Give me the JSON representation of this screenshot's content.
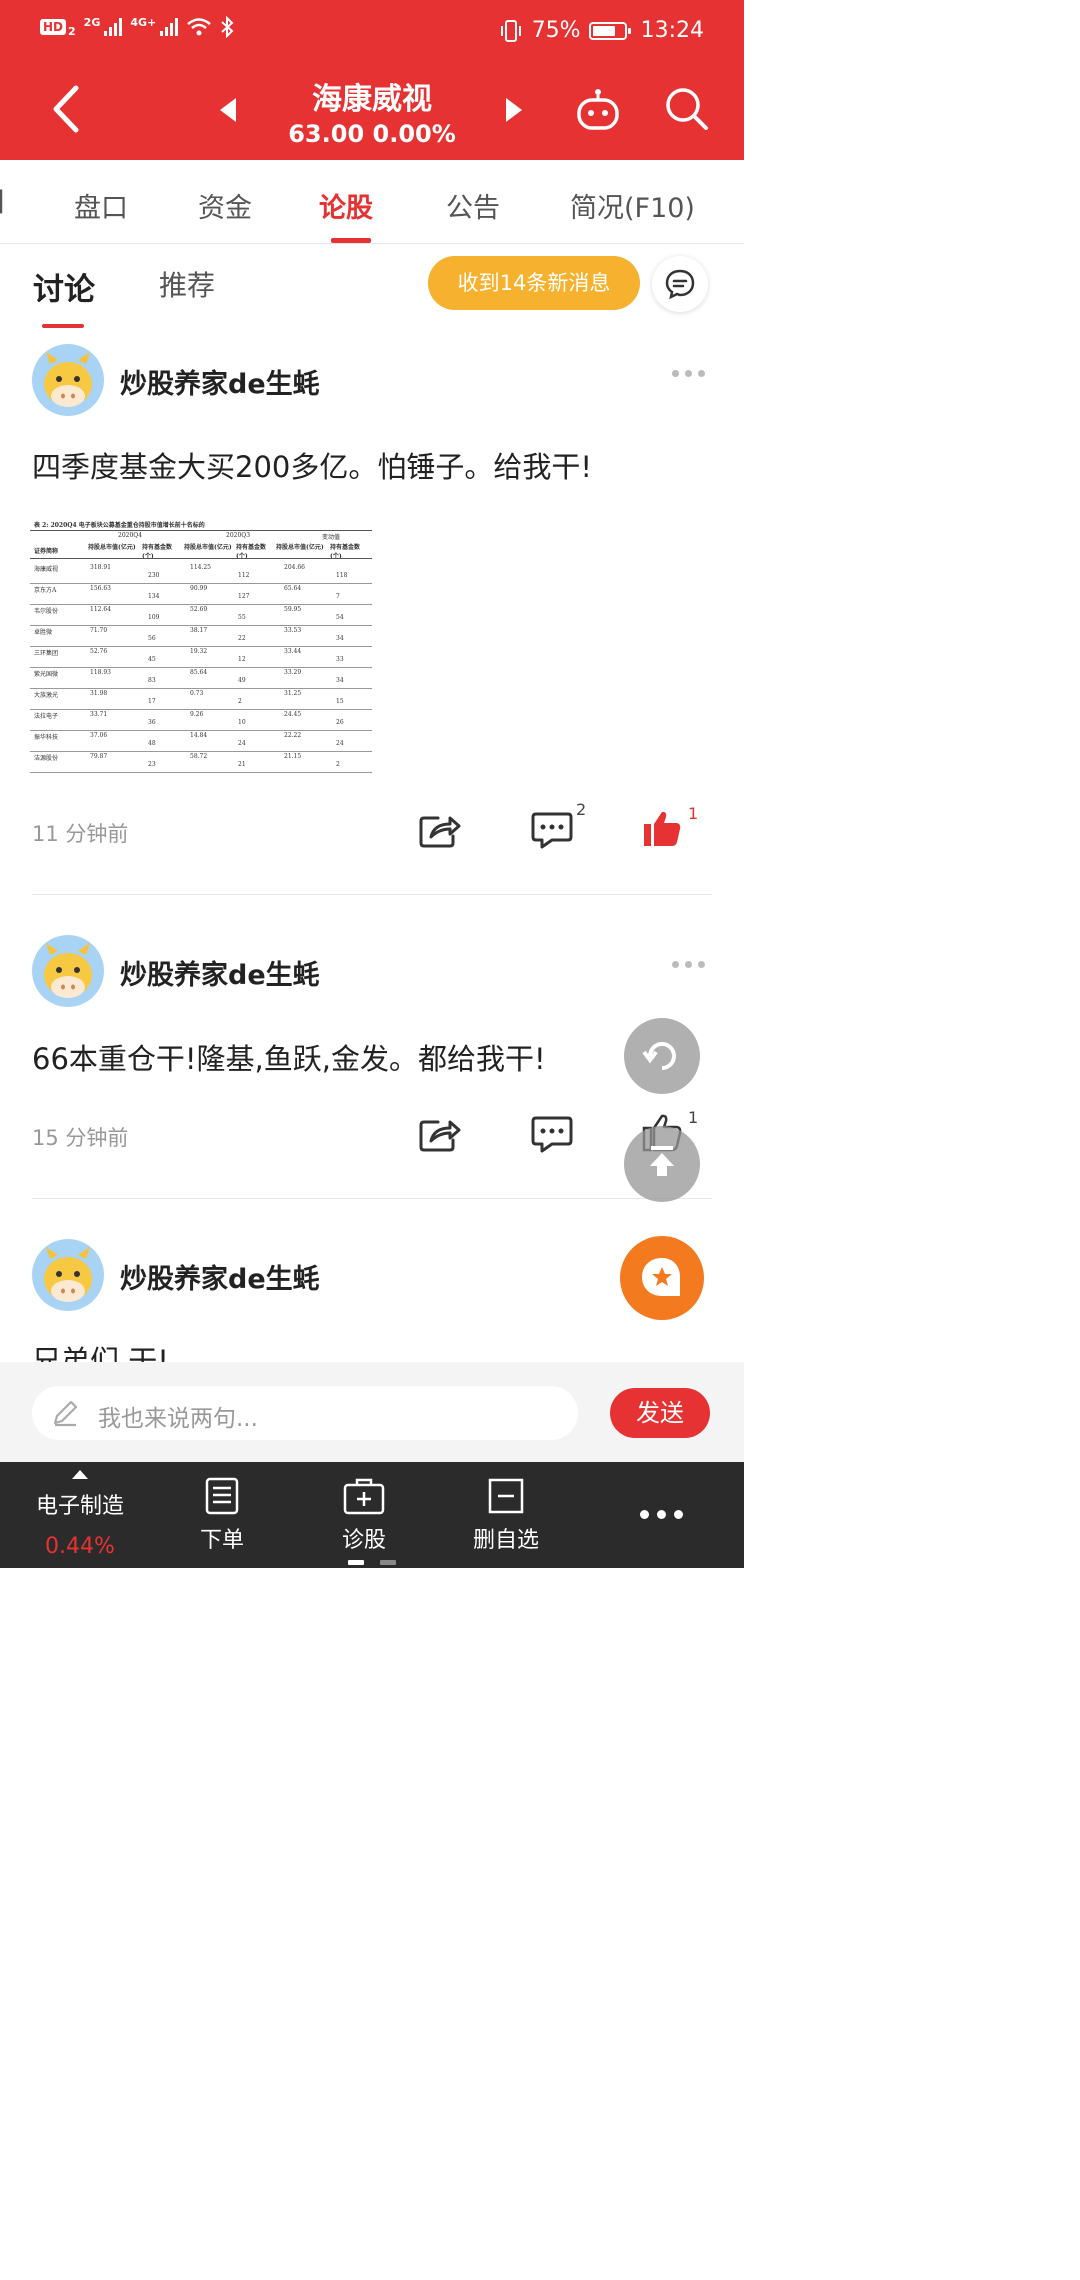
{
  "status_bar": {
    "hd": "HD",
    "sim": "2",
    "net1": "2G",
    "net2": "4G+",
    "battery": "75%",
    "time": "13:24"
  },
  "header": {
    "stock_name": "海康威视",
    "price_line": "63.00  0.00%"
  },
  "tabs": [
    "]",
    "盘口",
    "资金",
    "论股",
    "公告",
    "简况(F10)"
  ],
  "subtabs": {
    "discuss": "讨论",
    "recommend": "推荐",
    "new_messages": "收到14条新消息"
  },
  "posts": [
    {
      "username": "炒股养家de生蚝",
      "content": "四季度基金大买200多亿。怕锤子。给我干!",
      "time": "11 分钟前",
      "comments": "2",
      "likes": "1"
    },
    {
      "username": "炒股养家de生蚝",
      "content": "66本重仓干!隆基,鱼跃,金发。都给我干!",
      "time": "15 分钟前",
      "comments": "",
      "likes": "1"
    },
    {
      "username": "炒股养家de生蚝",
      "content": "兄弟们,干!"
    }
  ],
  "table_image": {
    "caption": "表 2: 2020Q4 电子板块公募基金重仓持股市值增长前十名标的",
    "groups": [
      "2020Q4",
      "2020Q3",
      "变动值"
    ],
    "headers": [
      "证券简称",
      "持股总市值(亿元)",
      "持有基金数(个)",
      "持股总市值(亿元)",
      "持有基金数(个)",
      "持股总市值(亿元)",
      "持有基金数(个)"
    ],
    "rows": [
      [
        "海康威视",
        "318.91",
        "230",
        "114.25",
        "112",
        "204.66",
        "118"
      ],
      [
        "京东方A",
        "156.63",
        "134",
        "90.99",
        "127",
        "65.64",
        "7"
      ],
      [
        "韦尔股份",
        "112.64",
        "109",
        "52.69",
        "55",
        "59.95",
        "54"
      ],
      [
        "卓胜微",
        "71.70",
        "56",
        "38.17",
        "22",
        "33.53",
        "34"
      ],
      [
        "三环集团",
        "52.76",
        "45",
        "19.32",
        "12",
        "33.44",
        "33"
      ],
      [
        "紫光国微",
        "118.93",
        "83",
        "85.64",
        "49",
        "33.29",
        "34"
      ],
      [
        "大族激光",
        "31.98",
        "17",
        "0.73",
        "2",
        "31.25",
        "15"
      ],
      [
        "法拉电子",
        "33.71",
        "36",
        "9.26",
        "10",
        "24.45",
        "26"
      ],
      [
        "振华科技",
        "37.06",
        "48",
        "14.84",
        "24",
        "22.22",
        "24"
      ],
      [
        "洁源股份",
        "79.87",
        "23",
        "58.72",
        "21",
        "21.15",
        "2"
      ]
    ]
  },
  "comment_bar": {
    "placeholder": "我也来说两句...",
    "send": "发送"
  },
  "bottom_nav": {
    "sector": "电子制造",
    "sector_change": "0.44%",
    "order": "下单",
    "diagnose": "诊股",
    "remove_watch": "删自选"
  },
  "colors": {
    "brand_red": "#e63232",
    "badge_orange": "#f6b12e",
    "fab_orange": "#f47a20",
    "nav_dark": "#2b2b2b"
  },
  "icons": [
    "back-arrow-icon",
    "prev-stock-icon",
    "next-stock-icon",
    "robot-icon",
    "search-icon",
    "chat-bubble-icon",
    "share-icon",
    "comment-icon",
    "like-icon",
    "pencil-icon",
    "more-icon"
  ]
}
